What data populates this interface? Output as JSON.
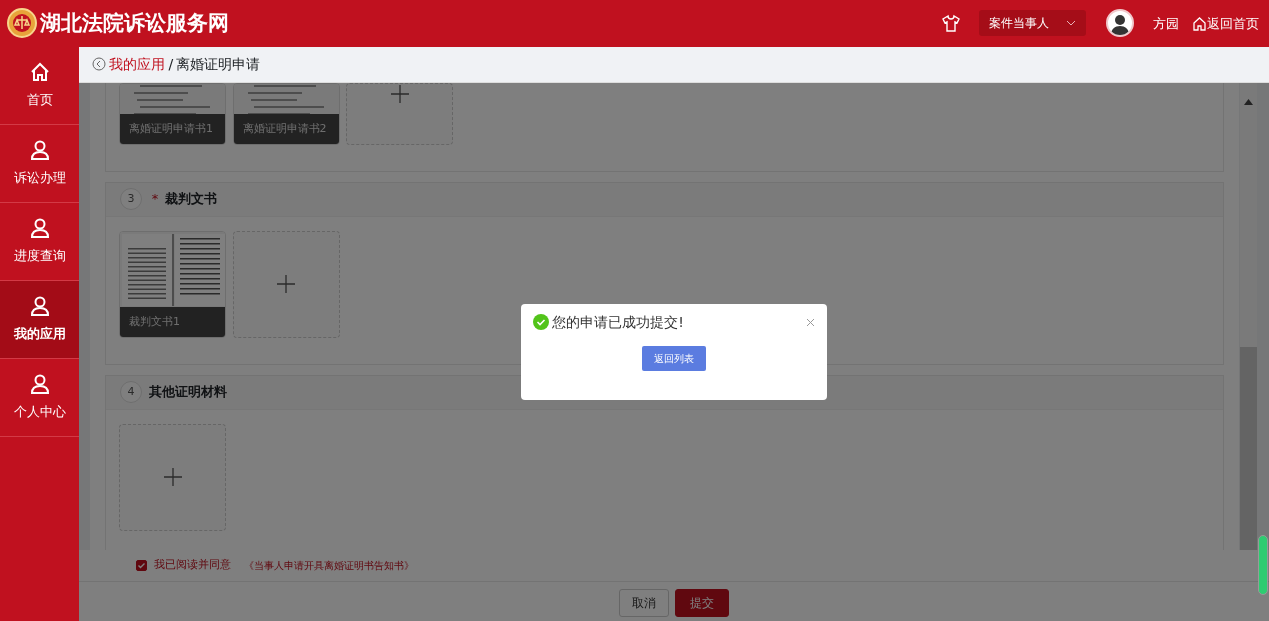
{
  "header": {
    "title": "湖北法院诉讼服务网",
    "role_select": {
      "value": "案件当事人"
    },
    "user_name": "方园",
    "home_link": "返回首页"
  },
  "sidebar": {
    "items": [
      {
        "label": "首页",
        "kind": "home",
        "selected": false
      },
      {
        "label": "诉讼办理",
        "kind": "user",
        "selected": false
      },
      {
        "label": "进度查询",
        "kind": "user",
        "selected": false
      },
      {
        "label": "我的应用",
        "kind": "user",
        "selected": true
      },
      {
        "label": "个人中心",
        "kind": "user",
        "selected": false
      }
    ]
  },
  "breadcrumb": {
    "parent": "我的应用",
    "separator": "/",
    "current": "离婚证明申请"
  },
  "sections": [
    {
      "files": [
        {
          "label": "离婚证明申请书1"
        },
        {
          "label": "离婚证明申请书2"
        }
      ]
    },
    {
      "number": "3",
      "required_mark": "*",
      "title": "裁判文书",
      "files": [
        {
          "label": "裁判文书1"
        }
      ]
    },
    {
      "number": "4",
      "title": "其他证明材料"
    }
  ],
  "agreement": {
    "checked": true,
    "label": "我已阅读并同意",
    "link": "《当事人申请开具离婚证明书告知书》"
  },
  "buttons": [
    {
      "label": "取消",
      "kind": "default"
    },
    {
      "label": "提交",
      "kind": "primary"
    }
  ],
  "dialog": {
    "message": "您的申请已成功提交!",
    "button": "返回列表"
  }
}
